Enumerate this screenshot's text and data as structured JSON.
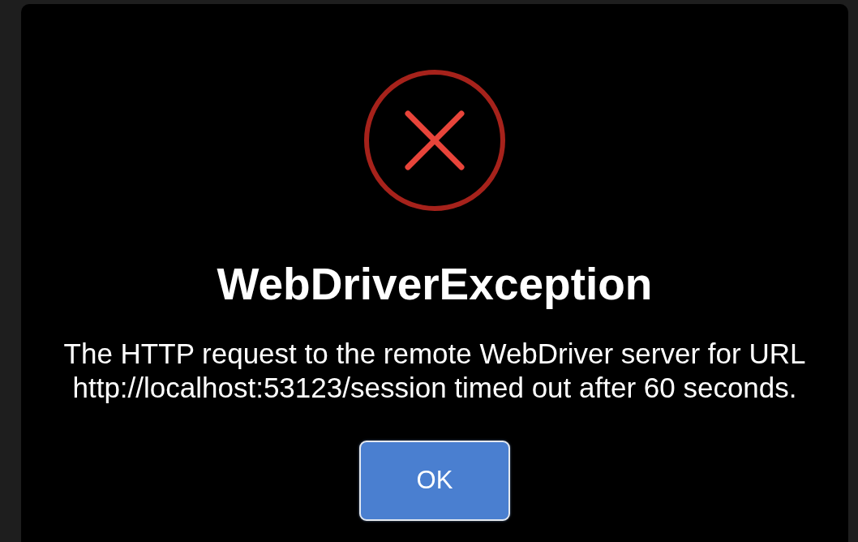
{
  "dialog": {
    "title": "WebDriverException",
    "message": "The HTTP request to the remote WebDriver server for URL http://localhost:53123/session timed out after 60 seconds.",
    "buttons": [
      "OK"
    ]
  }
}
